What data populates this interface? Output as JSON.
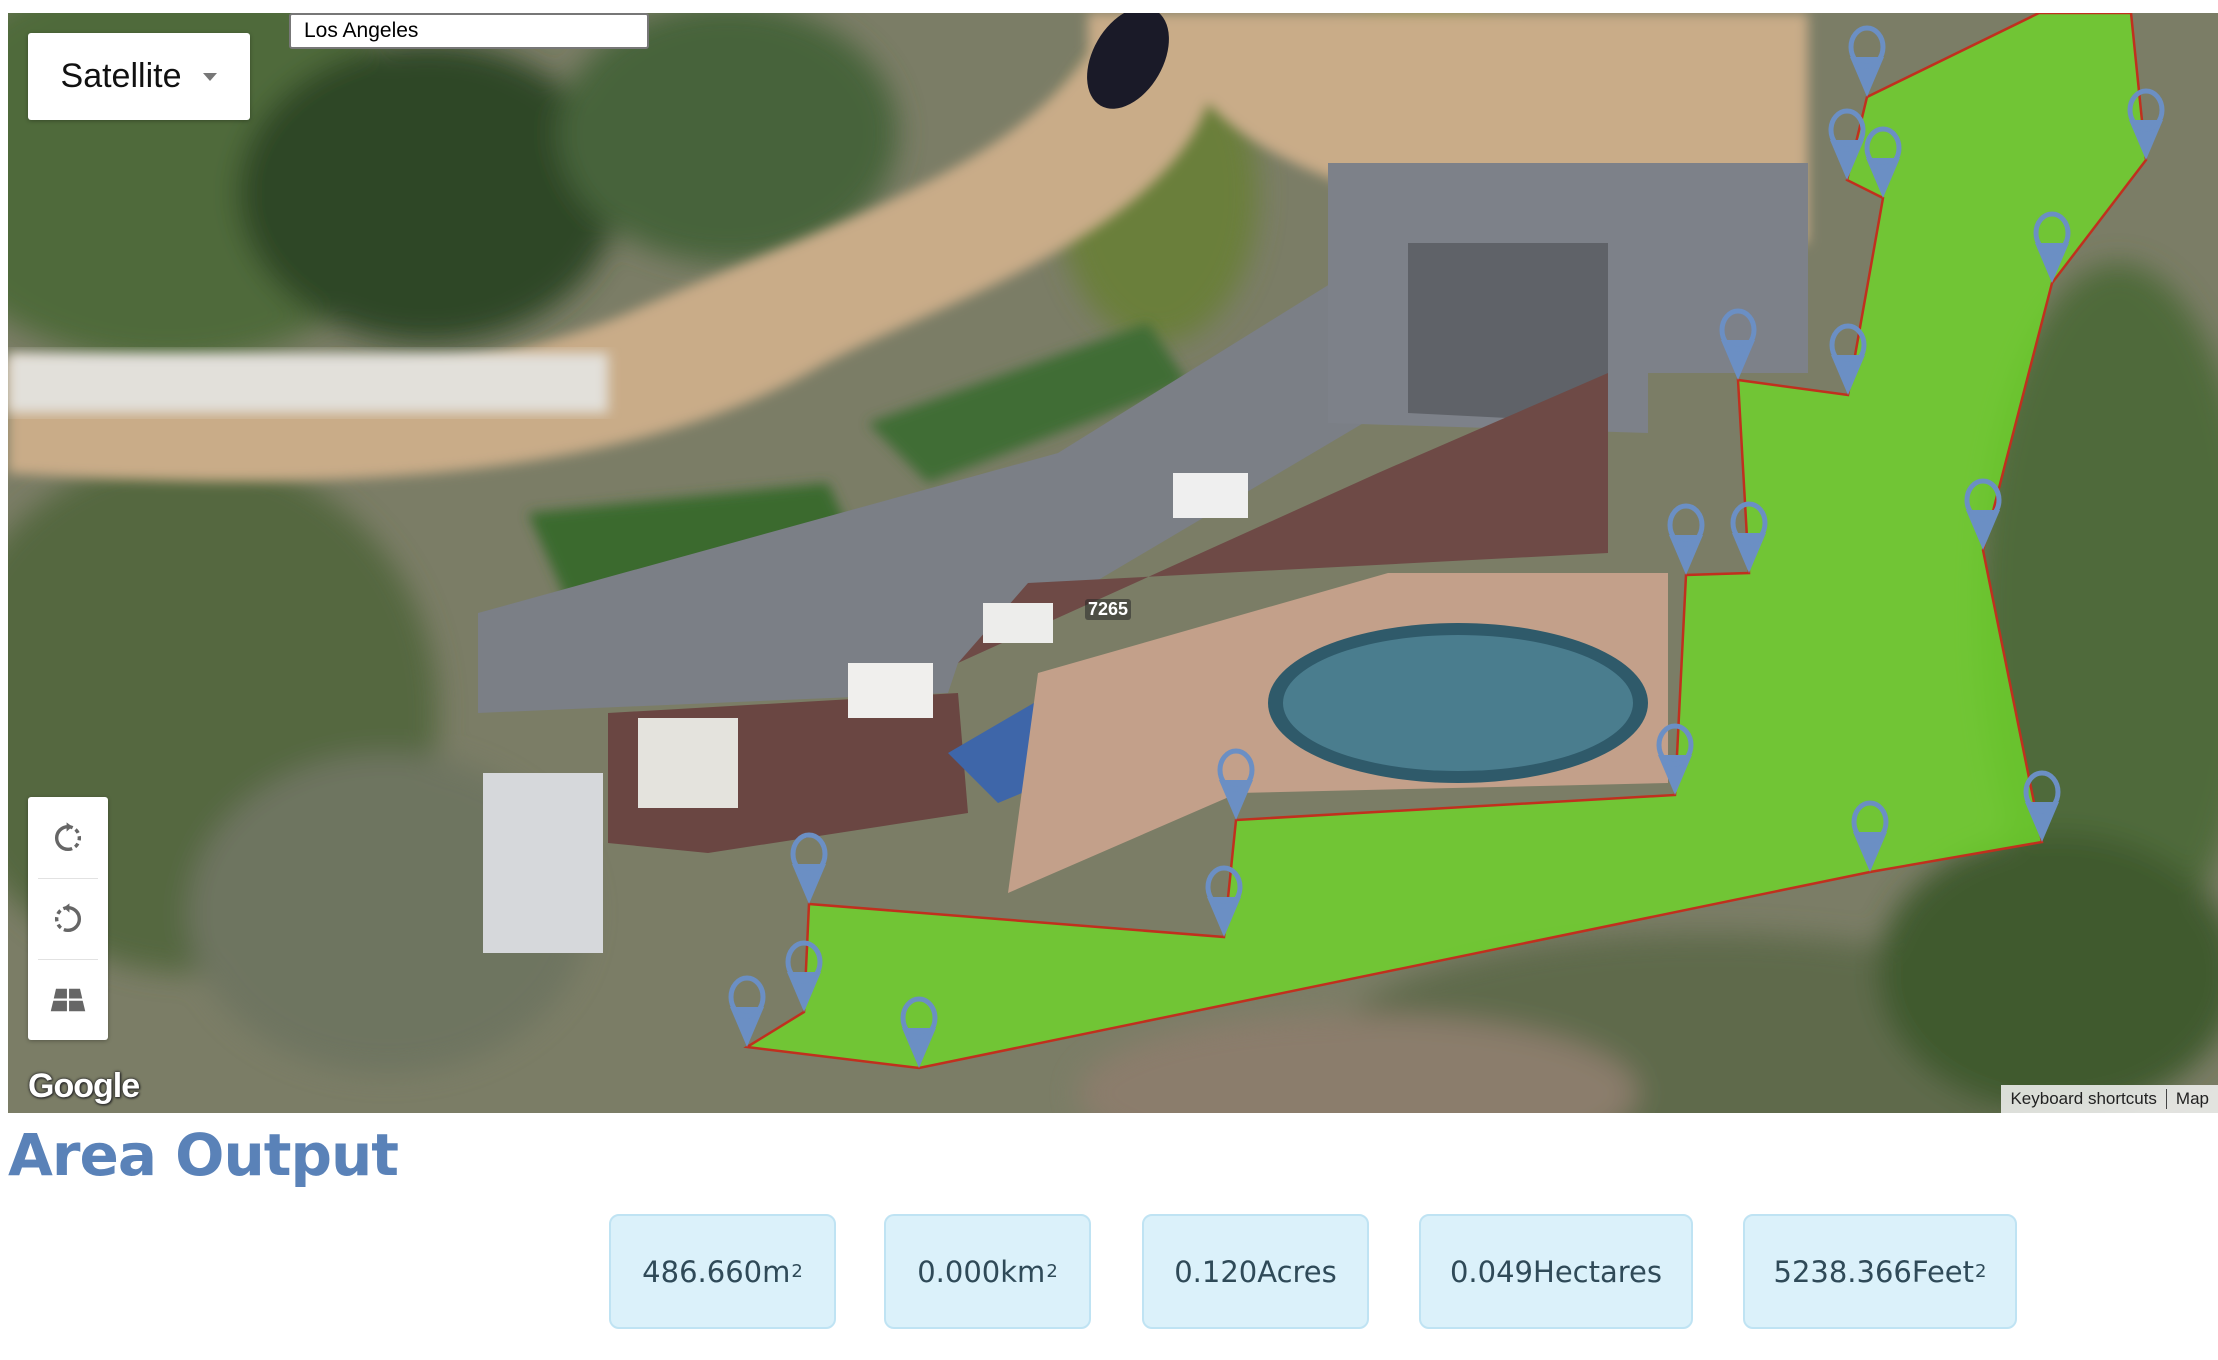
{
  "map": {
    "map_type_label": "Satellite",
    "search": {
      "value": "Los Angeles",
      "placeholder": ""
    },
    "controls": {
      "rotate_clockwise_icon": "rotate-clockwise-icon",
      "rotate_counterclockwise_icon": "rotate-counterclockwise-icon",
      "tilt_icon": "tilt-3d-icon"
    },
    "google_logo": "Google",
    "house_number": "7265",
    "attribution": {
      "keyboard_shortcuts": "Keyboard shortcuts",
      "map_data": "Map"
    },
    "colors": {
      "polygon_fill": "#6fd62b",
      "polygon_stroke": "#c0301e",
      "marker": "#6b8fc4"
    }
  },
  "output": {
    "title": "Area Output",
    "results": [
      {
        "value": "486.660",
        "unit": "m",
        "sup": "2"
      },
      {
        "value": "0.000",
        "unit": "km",
        "sup": "2"
      },
      {
        "value": "0.120",
        "unit": "Acres",
        "sup": ""
      },
      {
        "value": "0.049",
        "unit": "Hectares",
        "sup": ""
      },
      {
        "value": "5238.366",
        "unit": "Feet",
        "sup": "2"
      }
    ]
  }
}
